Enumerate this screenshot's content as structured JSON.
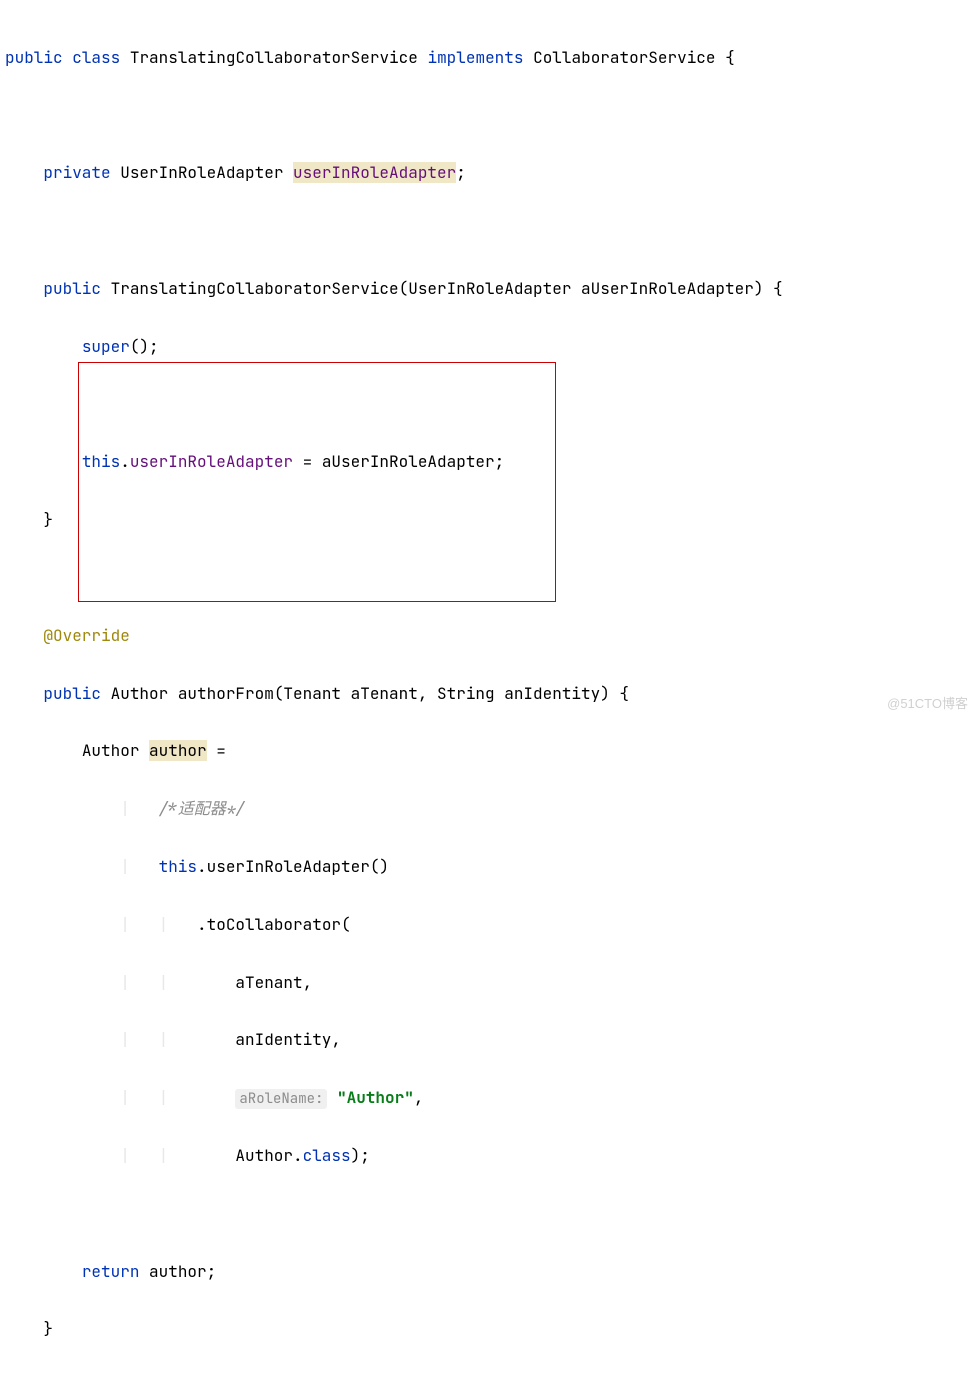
{
  "code": {
    "l1_kw_public": "public",
    "l1_kw_class": "class",
    "l1_classname": "TranslatingCollaboratorService",
    "l1_kw_implements": "implements",
    "l1_interface": "CollaboratorService",
    "l1_brace": "{",
    "l3_kw_private": "private",
    "l3_type": "UserInRoleAdapter",
    "l3_field": "userInRoleAdapter",
    "l3_semi": ";",
    "l5_kw_public": "public",
    "l5_ctor": "TranslatingCollaboratorService(UserInRoleAdapter aUserInRoleAdapter) {",
    "l6_kw_super": "super",
    "l6_rest": "();",
    "l8_kw_this": "this",
    "l8_dot": ".",
    "l8_field": "userInRoleAdapter",
    "l8_rest": " = aUserInRoleAdapter;",
    "l9_brace": "}",
    "l11_annotation": "@Override",
    "l12_kw_public": "public",
    "l12_sig": "Author authorFrom(Tenant aTenant, String anIdentity) {",
    "l13_type": "Author ",
    "l13_var": "author",
    "l13_eq": " =",
    "l14_comment": "/*适配器*/",
    "l15_kw_this": "this",
    "l15_rest": ".userInRoleAdapter()",
    "l16_text": ".toCollaborator(",
    "l17_text": "aTenant,",
    "l18_text": "anIdentity,",
    "l19_hint": "aRoleName:",
    "l19_space": " ",
    "l19_string": "\"Author\"",
    "l19_comma": ",",
    "l20_pre": "Author.",
    "l20_kw_class": "class",
    "l20_rest": ");",
    "l22_kw_return": "return",
    "l22_rest": " author;",
    "l23_brace": "}"
  },
  "watermark": "@51CTO博客"
}
